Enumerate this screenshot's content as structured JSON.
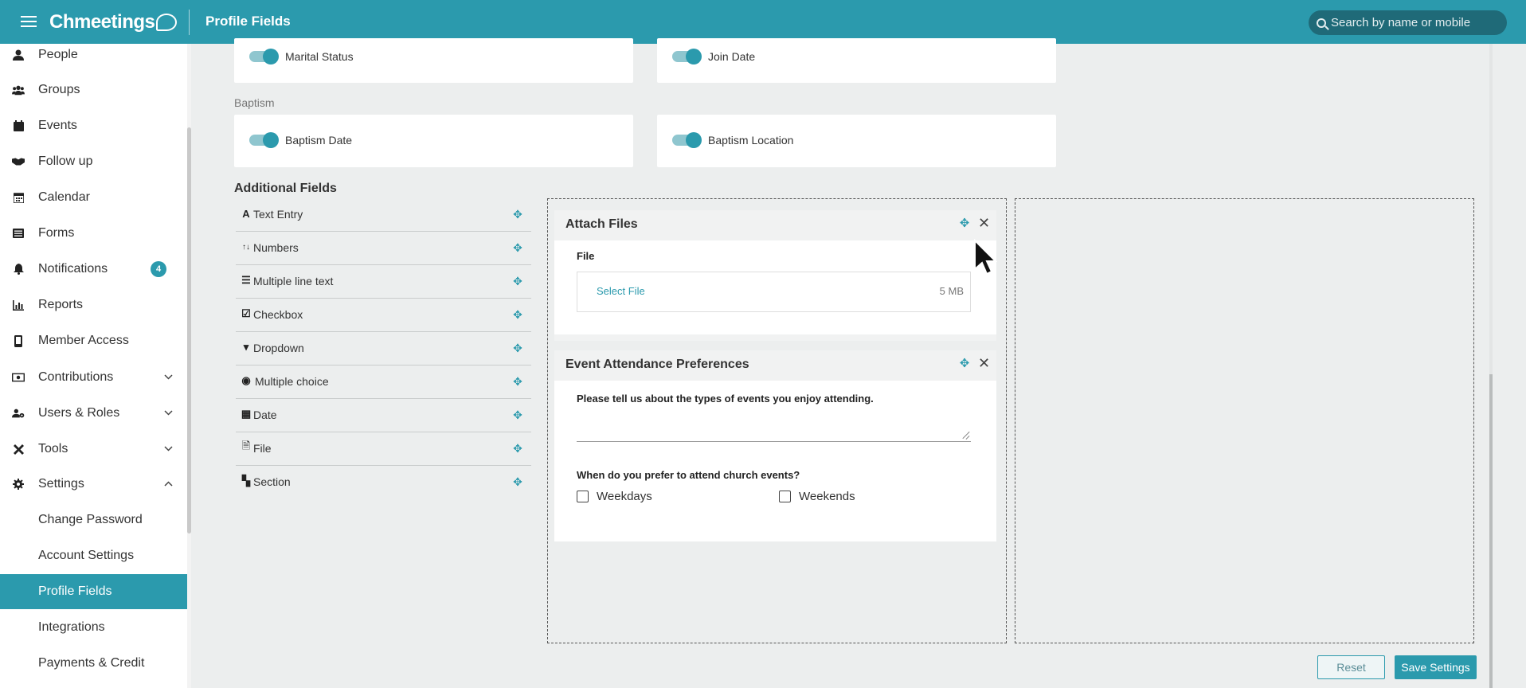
{
  "header": {
    "app_name": "Chmeetings",
    "page_title": "Profile Fields",
    "search_placeholder": "Search by name or mobile"
  },
  "sidebar": {
    "items": [
      {
        "label": "People",
        "icon": "person-icon"
      },
      {
        "label": "Groups",
        "icon": "users-icon"
      },
      {
        "label": "Events",
        "icon": "calendar-icon"
      },
      {
        "label": "Follow up",
        "icon": "handshake-icon"
      },
      {
        "label": "Calendar",
        "icon": "calendar-grid-icon"
      },
      {
        "label": "Forms",
        "icon": "list-icon"
      },
      {
        "label": "Notifications",
        "icon": "bell-icon",
        "badge": "4"
      },
      {
        "label": "Reports",
        "icon": "chart-icon"
      },
      {
        "label": "Member Access",
        "icon": "mobile-icon"
      },
      {
        "label": "Contributions",
        "icon": "money-icon",
        "expandable": true
      },
      {
        "label": "Users & Roles",
        "icon": "users-cog-icon",
        "expandable": true
      },
      {
        "label": "Tools",
        "icon": "tools-icon",
        "expandable": true
      },
      {
        "label": "Settings",
        "icon": "gear-icon",
        "expanded": true
      },
      {
        "label": "Change Password"
      },
      {
        "label": "Account Settings"
      },
      {
        "label": "Profile Fields",
        "active": true
      },
      {
        "label": "Integrations"
      },
      {
        "label": "Payments & Credit"
      }
    ]
  },
  "toggles": {
    "marital_status": "Marital Status",
    "join_date": "Join Date",
    "baptism_section": "Baptism",
    "baptism_date": "Baptism Date",
    "baptism_location": "Baptism Location"
  },
  "additional_fields": {
    "heading": "Additional Fields",
    "items": [
      {
        "label": "Text Entry",
        "icon": "A"
      },
      {
        "label": "Numbers",
        "icon": "↑↓"
      },
      {
        "label": "Multiple line text",
        "icon": "☰"
      },
      {
        "label": "Checkbox",
        "icon": "☑"
      },
      {
        "label": "Dropdown",
        "icon": "▾"
      },
      {
        "label": "Multiple choice",
        "icon": "◉"
      },
      {
        "label": "Date",
        "icon": "▦"
      },
      {
        "label": "File",
        "icon": "🗎"
      },
      {
        "label": "Section",
        "icon": "▚"
      }
    ]
  },
  "form_cards": {
    "attach_files": {
      "title": "Attach Files",
      "field_label": "File",
      "select_label": "Select File",
      "size_limit": "5 MB"
    },
    "event_prefs": {
      "title": "Event Attendance Preferences",
      "question1": "Please tell us about the types of events you enjoy attending.",
      "question2": "When do you prefer to attend church events?",
      "options": [
        "Weekdays",
        "Weekends"
      ]
    }
  },
  "buttons": {
    "reset": "Reset",
    "save": "Save Settings"
  },
  "colors": {
    "accent": "#2b9aad",
    "header_bg": "#2b9aad",
    "search_bg": "#1f6a78",
    "page_bg": "#eceeee"
  }
}
